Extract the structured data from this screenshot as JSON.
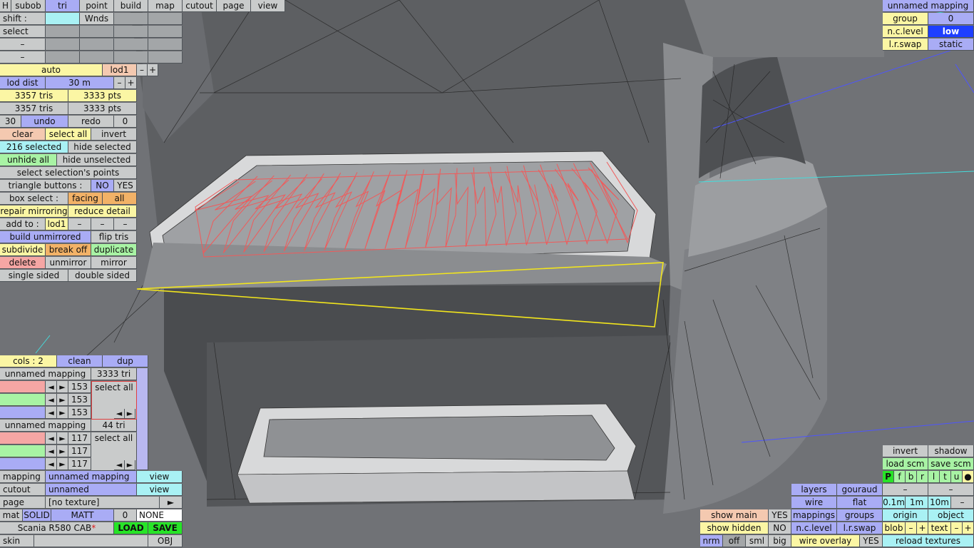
{
  "top_bar": {
    "h": "H",
    "subob": "subob",
    "tri": "tri",
    "point": "point",
    "build": "build",
    "map": "map",
    "cutout": "cutout",
    "page": "page",
    "view": "view"
  },
  "left": {
    "shift": "shift :",
    "wnds": "Wnds",
    "select": "select",
    "dash": "–",
    "auto": "auto",
    "lod1": "lod1",
    "minus": "–",
    "plus": "+",
    "lod_dist": "lod dist",
    "lod_dist_val": "30 m",
    "tris1": "3357 tris",
    "pts1": "3333 pts",
    "tris2": "3357 tris",
    "pts2": "3333 pts",
    "undo_count": "30",
    "undo": "undo",
    "redo": "redo",
    "redo_count": "0",
    "clear": "clear",
    "select_all": "select all",
    "invert": "invert",
    "selected": "216 selected",
    "hide_selected": "hide selected",
    "unhide_all": "unhide all",
    "hide_unselected": "hide unselected",
    "select_points": "select selection's points",
    "triangle_buttons": "triangle buttons :",
    "no": "NO",
    "yes": "YES",
    "box_select": "box select :",
    "facing": "facing",
    "all": "all",
    "repair_mirroring": "repair mirroring",
    "reduce_detail": "reduce detail",
    "add_to": "add to :",
    "add_lod1": "lod1",
    "build_unmirrored": "build unmirrored",
    "flip_tris": "flip tris",
    "subdivide": "subdivide",
    "break_off": "break off",
    "duplicate": "duplicate",
    "delete": "delete",
    "unmirror": "unmirror",
    "mirror": "mirror",
    "single_sided": "single sided",
    "double_sided": "double sided"
  },
  "map_panel": {
    "cols": "cols : 2",
    "clean": "clean",
    "dup": "dup",
    "m1_name": "unnamed mapping",
    "m1_tri": "3333 tri",
    "m1_v1": "153",
    "m1_v2": "153",
    "m1_v3": "153",
    "m2_name": "unnamed mapping",
    "m2_tri": "44 tri",
    "m2_v1": "117",
    "m2_v2": "117",
    "m2_v3": "117",
    "select_all": "select all",
    "arrow_l": "◄",
    "arrow_r": "►"
  },
  "bottom_left": {
    "mapping": "mapping",
    "mapping_val": "unnamed mapping",
    "view": "view",
    "cutout": "cutout",
    "cutout_val": "unnamed",
    "page": "page",
    "page_val": "[no texture]",
    "play": "►",
    "mat": "mat",
    "solid": "SOLID",
    "matt": "MATT",
    "zero": "0",
    "none": "NONE",
    "file": "Scania R580 CAB",
    "star": "*",
    "load": "LOAD",
    "save": "SAVE",
    "skin": "skin",
    "obj": "OBJ"
  },
  "top_right": {
    "mapping": "unnamed mapping",
    "group": "group",
    "group_val": "0",
    "nc_level": "n.c.level",
    "nc_val": "low",
    "lr_swap": "l.r.swap",
    "lr_val": "static"
  },
  "bottom_right": {
    "invert": "invert",
    "shadow": "shadow",
    "load_scm": "load scm",
    "save_scm": "save scm",
    "letters": [
      "P",
      "f",
      "b",
      "r",
      "l",
      "t",
      "u",
      "●"
    ],
    "layers": "layers",
    "gouraud": "gouraud",
    "wire": "wire",
    "flat": "flat",
    "d01": "0.1m",
    "d1": "1m",
    "d10": "10m",
    "dash": "–",
    "show_main": "show main",
    "yes": "YES",
    "mappings": "mappings",
    "groups": "groups",
    "origin": "origin",
    "object": "object",
    "show_hidden": "show hidden",
    "no": "NO",
    "nc_level": "n.c.level",
    "lr_swap": "l.r.swap",
    "blob": "blob",
    "text": "text",
    "minus": "–",
    "plus": "+",
    "nrm": "nrm",
    "off": "off",
    "sml": "sml",
    "big": "big",
    "wire_overlay": "wire overlay",
    "reload": "reload textures"
  }
}
